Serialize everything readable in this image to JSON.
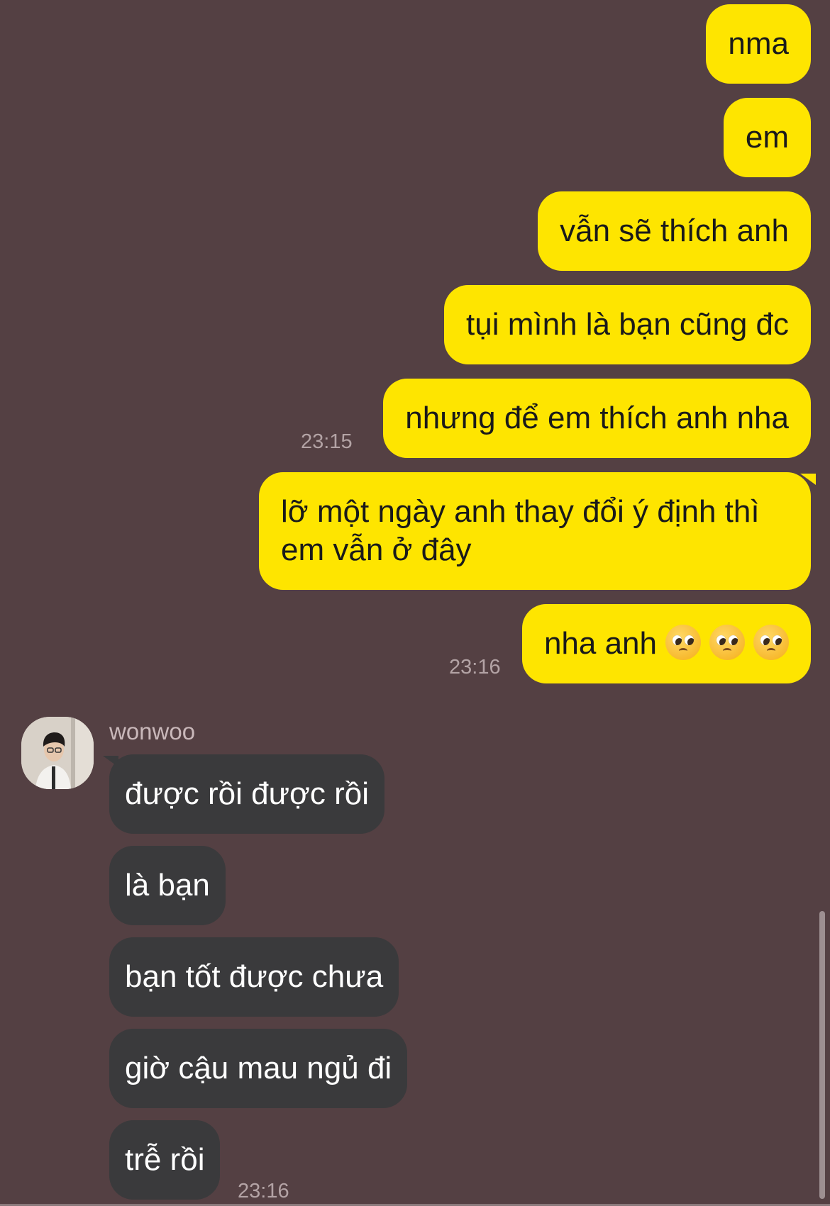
{
  "conversation": {
    "outgoing": [
      {
        "text": "nma"
      },
      {
        "text": "em"
      },
      {
        "text": "vẫn sẽ thích anh"
      },
      {
        "text": "tụi mình là bạn cũng đc"
      },
      {
        "text": "nhưng để em thích anh nha"
      },
      {
        "text": "lỡ một ngày anh thay đổi ý định thì em vẫn ở đây"
      },
      {
        "text": "nha anh"
      }
    ],
    "outgoing_times": [
      "23:15",
      "23:16"
    ],
    "emoji_name": "pleading-face",
    "emoji_count": 3,
    "contact": {
      "name": "wonwoo"
    },
    "incoming": [
      {
        "text": "được rồi được rồi"
      },
      {
        "text": "là bạn"
      },
      {
        "text": "bạn tốt được chưa"
      },
      {
        "text": "giờ cậu mau ngủ đi"
      },
      {
        "text": "trễ rồi"
      }
    ],
    "incoming_time": "23:16"
  },
  "colors": {
    "background": "#544043",
    "outgoing_bubble": "#FEE500",
    "incoming_bubble": "#3a3a3c",
    "timestamp": "#b3a3a5"
  }
}
